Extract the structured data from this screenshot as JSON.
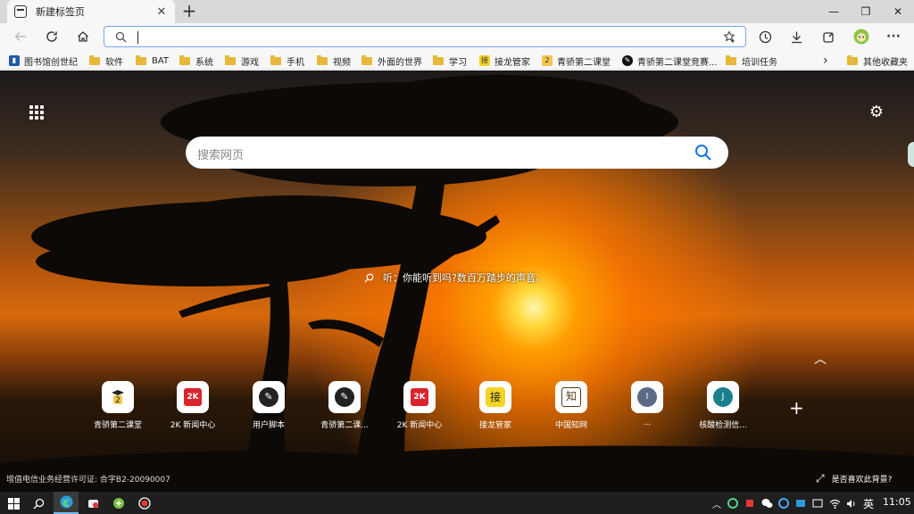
{
  "browser": {
    "tab_title": "新建标签页",
    "new_tab_label": "+",
    "window_controls": {
      "minimize": "—",
      "maximize": "❐",
      "close": "✕"
    }
  },
  "address_bar": {
    "value": "",
    "placeholder": ""
  },
  "bookmarks": [
    {
      "label": "图书馆创世纪",
      "kind": "site"
    },
    {
      "label": "软件",
      "kind": "folder"
    },
    {
      "label": "BAT",
      "kind": "folder"
    },
    {
      "label": "系统",
      "kind": "folder"
    },
    {
      "label": "游戏",
      "kind": "folder"
    },
    {
      "label": "手机",
      "kind": "folder"
    },
    {
      "label": "视频",
      "kind": "folder"
    },
    {
      "label": "外面的世界",
      "kind": "folder"
    },
    {
      "label": "学习",
      "kind": "folder"
    },
    {
      "label": "接龙管家",
      "kind": "site"
    },
    {
      "label": "青骄第二课堂",
      "kind": "site"
    },
    {
      "label": "青骄第二课堂竞赛...",
      "kind": "site"
    },
    {
      "label": "培训任务",
      "kind": "folder"
    }
  ],
  "bookmarks_more": "›",
  "bookmarks_other": "其他收藏夹",
  "ntp": {
    "search_placeholder": "搜索网页",
    "caption": "听：你能听到吗?数百万踏步的声音。",
    "like_background": "是否喜欢此背景?",
    "license": "增值电信业务经营许可证: 合字B2-20090007",
    "add_tile": "+",
    "tiles": [
      {
        "label": "青骄第二课堂",
        "icon": "qingjiao-icon",
        "color": "#f3c84a"
      },
      {
        "label": "2K 新闻中心",
        "icon": "2k-icon",
        "color": "#d9232d"
      },
      {
        "label": "用户脚本",
        "icon": "script-icon",
        "color": "#222222"
      },
      {
        "label": "青骄第二课...",
        "icon": "script-icon",
        "color": "#222222"
      },
      {
        "label": "2K 新闻中心",
        "icon": "2k-icon",
        "color": "#d9232d"
      },
      {
        "label": "接龙管家",
        "icon": "jielong-icon",
        "color": "#f5d327"
      },
      {
        "label": "中国知网",
        "icon": "cnki-icon",
        "color": "#5a3a1a"
      },
      {
        "label": "...",
        "icon": "letter-i-icon",
        "letter": "I",
        "color": "#5b6b86"
      },
      {
        "label": "核酸检测信...",
        "icon": "letter-j-icon",
        "letter": "J",
        "color": "#1c7f90"
      }
    ]
  },
  "taskbar": {
    "ime": "英",
    "time": "11:05"
  }
}
